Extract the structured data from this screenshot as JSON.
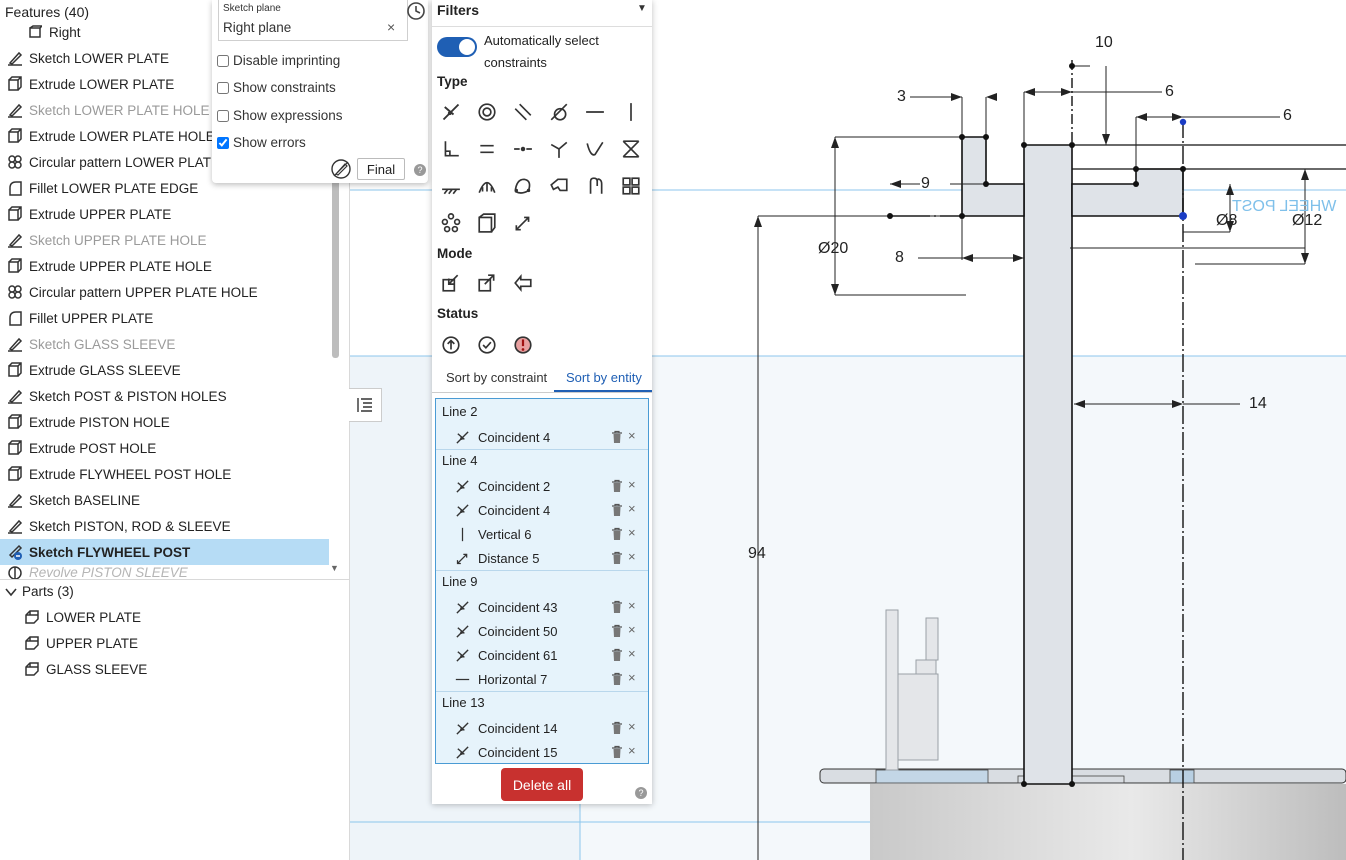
{
  "features": {
    "title": "Features (40)",
    "items": [
      {
        "label": "Right",
        "icon": "plane-icon",
        "state": "normal"
      },
      {
        "label": "Sketch LOWER PLATE",
        "icon": "sketch-icon",
        "state": "normal"
      },
      {
        "label": "Extrude LOWER PLATE",
        "icon": "extrude-icon",
        "state": "normal"
      },
      {
        "label": "Sketch LOWER PLATE HOLE",
        "icon": "sketch-icon",
        "state": "dim"
      },
      {
        "label": "Extrude LOWER PLATE HOLE",
        "icon": "extrude-icon",
        "state": "normal"
      },
      {
        "label": "Circular pattern LOWER PLATE HOLES",
        "icon": "pattern-icon",
        "state": "normal"
      },
      {
        "label": "Fillet LOWER PLATE EDGE",
        "icon": "fillet-icon",
        "state": "normal"
      },
      {
        "label": "Extrude UPPER PLATE",
        "icon": "extrude-icon",
        "state": "normal"
      },
      {
        "label": "Sketch UPPER PLATE HOLE",
        "icon": "sketch-icon",
        "state": "dim"
      },
      {
        "label": "Extrude UPPER PLATE HOLE",
        "icon": "extrude-icon",
        "state": "normal"
      },
      {
        "label": "Circular pattern UPPER PLATE HOLE",
        "icon": "pattern-icon",
        "state": "normal"
      },
      {
        "label": "Fillet UPPER PLATE",
        "icon": "fillet-icon",
        "state": "normal"
      },
      {
        "label": "Sketch GLASS SLEEVE",
        "icon": "sketch-icon",
        "state": "dim"
      },
      {
        "label": "Extrude GLASS SLEEVE",
        "icon": "extrude-icon",
        "state": "normal"
      },
      {
        "label": "Sketch POST & PISTON HOLES",
        "icon": "sketch-icon",
        "state": "normal"
      },
      {
        "label": "Extrude PISTON HOLE",
        "icon": "extrude-icon",
        "state": "normal"
      },
      {
        "label": "Extrude POST HOLE",
        "icon": "extrude-icon",
        "state": "normal"
      },
      {
        "label": "Extrude FLYWHEEL POST HOLE",
        "icon": "extrude-icon",
        "state": "normal"
      },
      {
        "label": "Sketch BASELINE",
        "icon": "sketch-icon",
        "state": "normal"
      },
      {
        "label": "Sketch PISTON, ROD & SLEEVE",
        "icon": "sketch-icon",
        "state": "normal"
      },
      {
        "label": "Sketch FLYWHEEL POST",
        "icon": "sketch-error-icon",
        "state": "selected"
      },
      {
        "label": "Revolve PISTON SLEEVE",
        "icon": "revolve-icon",
        "state": "rolled"
      }
    ]
  },
  "parts": {
    "title": "Parts (3)",
    "items": [
      "LOWER PLATE",
      "UPPER PLATE",
      "GLASS SLEEVE"
    ]
  },
  "sketch_popup": {
    "plane_label": "Sketch plane",
    "plane_value": "Right plane",
    "close_glyph": "×",
    "options": [
      {
        "label": "Disable imprinting",
        "checked": false
      },
      {
        "label": "Show constraints",
        "checked": false
      },
      {
        "label": "Show expressions",
        "checked": false
      },
      {
        "label": "Show errors",
        "checked": true
      }
    ],
    "final_label": "Final",
    "help_glyph": "?"
  },
  "filters": {
    "title": "Filters",
    "auto_select_label": "Automatically select constraints",
    "auto_select_on": true,
    "type_title": "Type",
    "mode_title": "Mode",
    "status_title": "Status",
    "type_icons": [
      "coincident-icon",
      "concentric-icon",
      "parallel-icon",
      "tangent-icon",
      "horizontal-icon",
      "vertical-icon",
      "perpendicular-icon",
      "equal-icon",
      "midpoint-icon",
      "normal-icon",
      "curvature-icon",
      "symmetric-icon",
      "fix-icon",
      "pierce-icon",
      "spline-icon",
      "offset-icon",
      "mirror-icon",
      "pattern-constraint-icon",
      "circular-pattern-icon",
      "projected-icon",
      "dimension-icon"
    ],
    "mode_icons": [
      "driving-mode-icon",
      "driven-mode-icon",
      "arrow-left-icon"
    ],
    "status_icons": [
      "under-defined-icon",
      "fully-defined-icon",
      "over-defined-icon"
    ],
    "tab_constraint": "Sort by constraint",
    "tab_entity": "Sort by entity",
    "groups": [
      {
        "title": "Line 2",
        "items": [
          {
            "label": "Coincident 4",
            "icon": "coincident-icon"
          }
        ]
      },
      {
        "title": "Line 4",
        "items": [
          {
            "label": "Coincident 2",
            "icon": "coincident-icon"
          },
          {
            "label": "Coincident 4",
            "icon": "coincident-icon"
          },
          {
            "label": "Vertical 6",
            "icon": "vertical-icon"
          },
          {
            "label": "Distance 5",
            "icon": "dimension-icon"
          }
        ]
      },
      {
        "title": "Line 9",
        "items": [
          {
            "label": "Coincident 43",
            "icon": "coincident-icon"
          },
          {
            "label": "Coincident 50",
            "icon": "coincident-icon"
          },
          {
            "label": "Coincident 61",
            "icon": "coincident-icon"
          },
          {
            "label": "Horizontal 7",
            "icon": "horizontal-icon"
          }
        ]
      },
      {
        "title": "Line 13",
        "items": [
          {
            "label": "Coincident 14",
            "icon": "coincident-icon"
          },
          {
            "label": "Coincident 15",
            "icon": "coincident-icon"
          }
        ]
      }
    ],
    "delete_all_label": "Delete all",
    "help_glyph": "?"
  },
  "viewport": {
    "dimensions": [
      "10",
      "3",
      "6",
      "6",
      "9",
      "Ø20",
      "Ø8",
      "Ø12",
      "8",
      "14",
      "94"
    ],
    "wheel_text": "WHEEL POST",
    "colors": {
      "sketch": "#111111",
      "selection": "#1a3cc4",
      "plane": "#8cc6ec",
      "region": "#dfe3e8"
    }
  }
}
